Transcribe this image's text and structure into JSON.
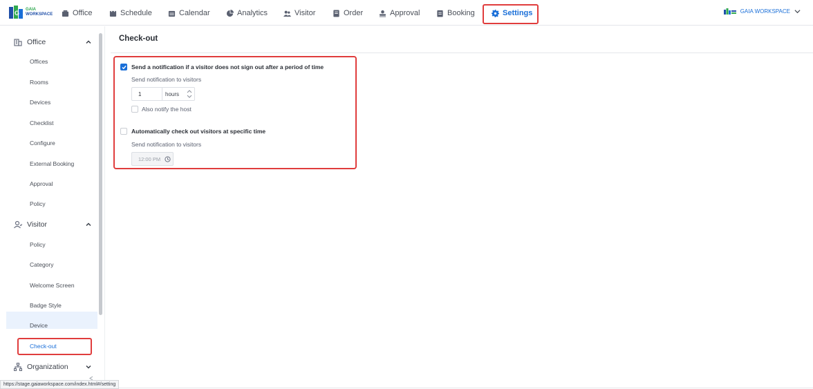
{
  "app": {
    "logo_text_line1": "GAIA",
    "logo_text_line2": "WORKSPACE",
    "brand_color": "#1a6fd8",
    "highlight_color": "#e03c3c"
  },
  "nav": {
    "items": [
      {
        "label": "Office",
        "icon": "office-icon"
      },
      {
        "label": "Schedule",
        "icon": "schedule-icon"
      },
      {
        "label": "Calendar",
        "icon": "calendar-icon"
      },
      {
        "label": "Analytics",
        "icon": "analytics-icon"
      },
      {
        "label": "Visitor",
        "icon": "visitor-icon"
      },
      {
        "label": "Order",
        "icon": "order-icon"
      },
      {
        "label": "Approval",
        "icon": "approval-icon"
      },
      {
        "label": "Booking",
        "icon": "booking-icon"
      },
      {
        "label": "Settings",
        "icon": "gear-icon",
        "active": true
      }
    ],
    "workspace_label": "GAIA WORKSPACE"
  },
  "sidebar": {
    "office": {
      "label": "Office",
      "items": [
        "Offices",
        "Rooms",
        "Devices",
        "Checklist",
        "Configure",
        "External Booking",
        "Approval",
        "Policy"
      ]
    },
    "visitor": {
      "label": "Visitor",
      "items": [
        "Policy",
        "Category",
        "Welcome Screen",
        "Badge Style",
        "Device",
        "Check-out"
      ],
      "active_item": "Check-out"
    },
    "organization": {
      "label": "Organization"
    }
  },
  "content": {
    "title": "Check-out",
    "option1": {
      "label": "Send a notification if a visitor does not sign out after a period of time",
      "checked": true,
      "sub_label": "Send notification to visitors",
      "value": "1",
      "unit": "hours",
      "notify_host_label": "Also notify the host",
      "notify_host_checked": false
    },
    "option2": {
      "label": "Automatically check out visitors at specific time",
      "checked": false,
      "sub_label": "Send notification to visitors",
      "time": "12:00 PM"
    }
  },
  "status_bar": {
    "url": "https://stage.gaiaworkspace.com/index.html#/setting"
  }
}
